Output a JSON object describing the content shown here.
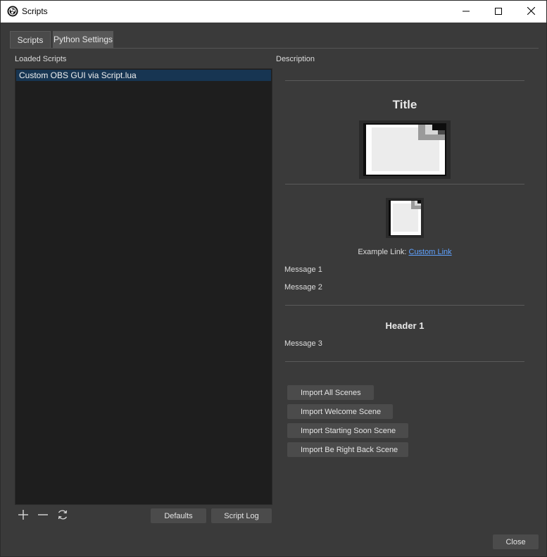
{
  "window": {
    "title": "Scripts"
  },
  "tabs": [
    {
      "label": "Scripts"
    },
    {
      "label": "Python Settings"
    }
  ],
  "left": {
    "label": "Loaded Scripts",
    "scripts": [
      "Custom OBS GUI via Script.lua"
    ],
    "defaults_label": "Defaults",
    "script_log_label": "Script Log"
  },
  "right": {
    "label": "Description",
    "title": "Title",
    "link_prefix": "Example Link:",
    "link_text": "Custom Link",
    "message1": "Message 1",
    "message2": "Message 2",
    "header1": "Header 1",
    "message3": "Message 3",
    "buttons": [
      {
        "label": "Import All Scenes"
      },
      {
        "label": "Import Welcome Scene"
      },
      {
        "label": "Import Starting Soon Scene"
      },
      {
        "label": "Import Be Right Back Scene"
      }
    ]
  },
  "footer": {
    "close_label": "Close"
  },
  "colors": {
    "link": "#5fa2ff",
    "selection": "#173552",
    "background": "#3a3a3a"
  },
  "icons": [
    "obs-icon",
    "minimize-icon",
    "maximize-icon",
    "close-icon",
    "add-icon",
    "remove-icon",
    "refresh-icon",
    "image-icon"
  ]
}
